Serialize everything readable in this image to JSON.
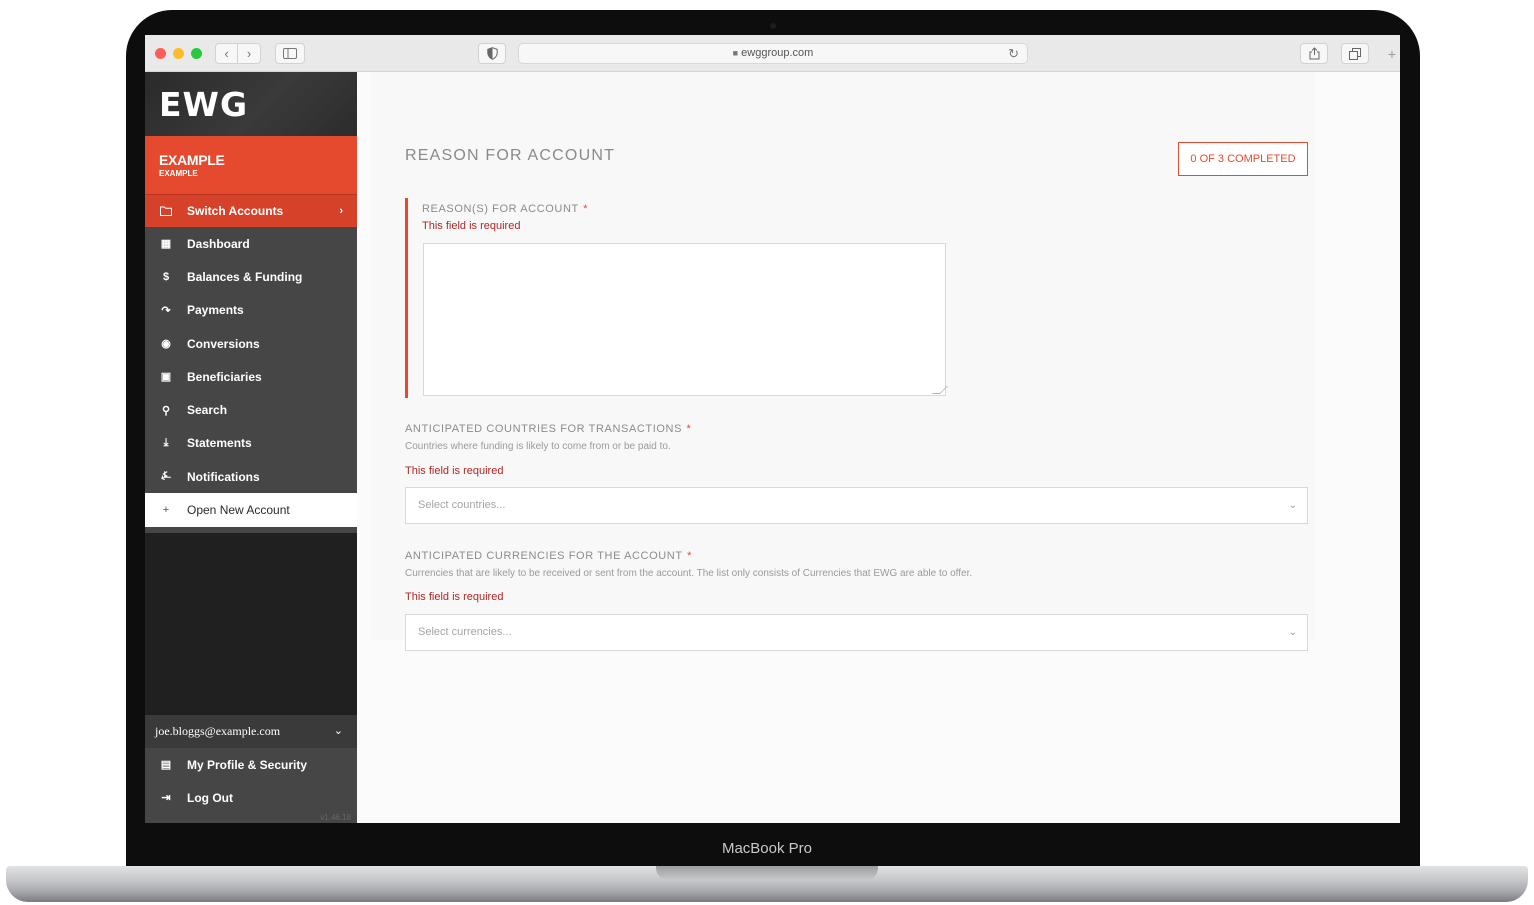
{
  "device": {
    "label": "MacBook Pro"
  },
  "browser": {
    "url": "ewggroup.com",
    "lock_icon": "lock-icon"
  },
  "sidebar": {
    "logo": "EWG",
    "account": {
      "name": "EXAMPLE",
      "sub": "EXAMPLE"
    },
    "switch_accounts": {
      "label": "Switch Accounts",
      "icon": "folder-icon"
    },
    "nav_items": [
      {
        "label": "Dashboard",
        "icon": "grid-icon"
      },
      {
        "label": "Balances & Funding",
        "icon": "dollar-icon"
      },
      {
        "label": "Payments",
        "icon": "send-arrow-icon"
      },
      {
        "label": "Conversions",
        "icon": "globe-icon"
      },
      {
        "label": "Beneficiaries",
        "icon": "address-book-icon"
      },
      {
        "label": "Search",
        "icon": "search-icon"
      },
      {
        "label": "Statements",
        "icon": "download-icon"
      },
      {
        "label": "Notifications",
        "icon": "bell-icon"
      },
      {
        "label": "Open New Account",
        "icon": "plus-icon",
        "active": true
      }
    ],
    "user": {
      "email": "joe.bloggs@example.com"
    },
    "user_items": [
      {
        "label": "My Profile & Security",
        "icon": "id-card-icon"
      },
      {
        "label": "Log Out",
        "icon": "logout-icon"
      }
    ],
    "version": "v1.46.18"
  },
  "main": {
    "title": "REASON FOR ACCOUNT",
    "progress": "0 OF 3 COMPLETED",
    "fields": {
      "reason": {
        "label": "REASON(S) FOR ACCOUNT",
        "required_mark": "*",
        "error": "This field is required",
        "value": ""
      },
      "countries": {
        "label": "ANTICIPATED COUNTRIES FOR TRANSACTIONS",
        "required_mark": "*",
        "help": "Countries where funding is likely to come from or be paid to.",
        "error": "This field is required",
        "placeholder": "Select countries..."
      },
      "currencies": {
        "label": "ANTICIPATED CURRENCIES FOR THE ACCOUNT",
        "required_mark": "*",
        "help": "Currencies that are likely to be received or sent from the account. The list only consists of Currencies that EWG are able to offer.",
        "error": "This field is required",
        "placeholder": "Select currencies..."
      }
    }
  },
  "colors": {
    "accent": "#e5492e",
    "sidebar_bg": "#464646",
    "error": "#b32525"
  }
}
